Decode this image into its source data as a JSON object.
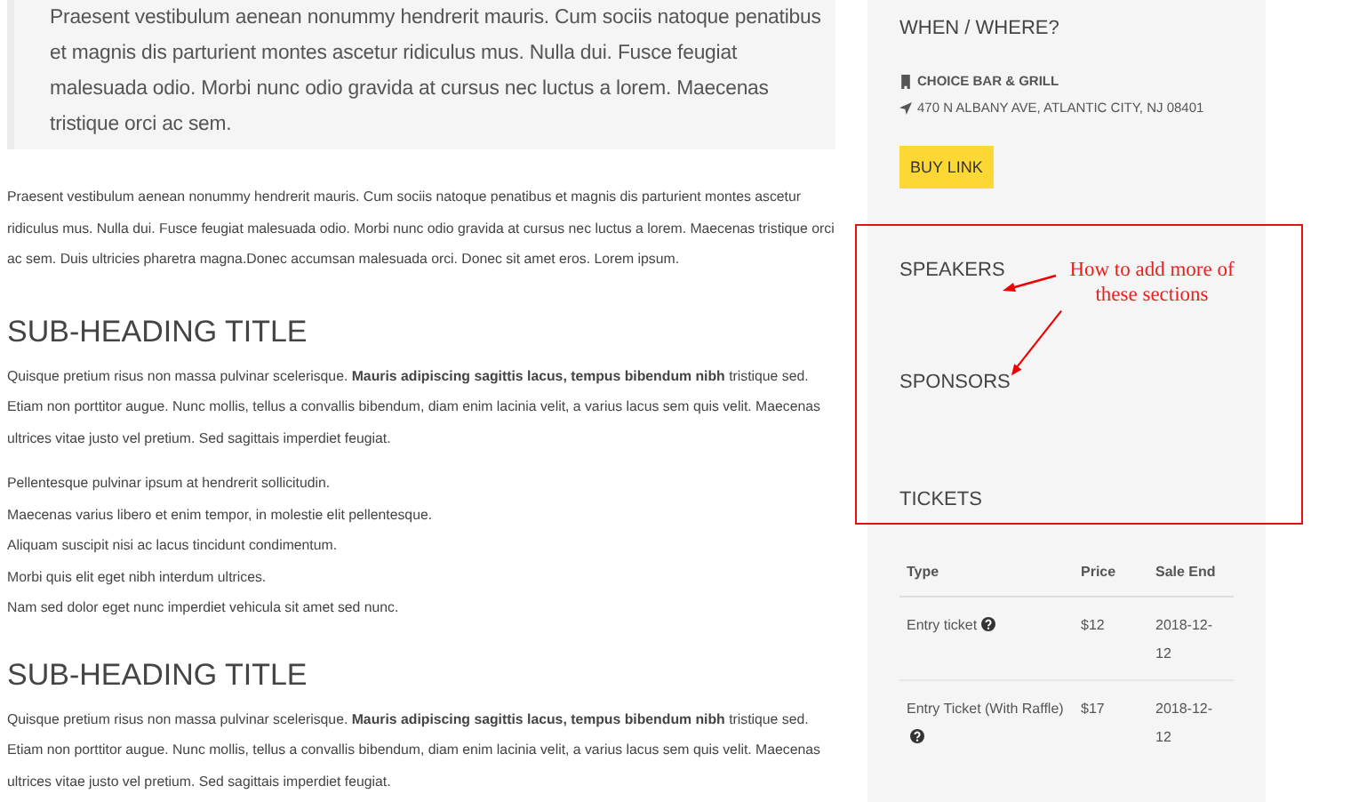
{
  "blockquote": "Praesent vestibulum aenean nonummy hendrerit mauris. Cum sociis natoque penatibus et magnis dis parturient montes ascetur ridiculus mus. Nulla dui. Fusce feugiat malesuada odio. Morbi nunc odio gravida at cursus nec luctus a lorem. Maecenas tristique orci ac sem.",
  "intro": "Praesent vestibulum aenean nonummy hendrerit mauris. Cum sociis natoque penatibus et magnis dis parturient montes ascetur ridiculus mus. Nulla dui. Fusce feugiat malesuada odio. Morbi nunc odio gravida at cursus nec luctus a lorem. Maecenas tristique orci ac sem. Duis ultricies pharetra magna.Donec accumsan malesuada orci. Donec sit amet eros. Lorem ipsum.",
  "sections": [
    {
      "heading": "SUB-HEADING TITLE",
      "paragraph": "Quisque pretium risus non massa pulvinar scelerisque. **Mauris adipiscing sagittis lacus, tempus bibendum nibh** tristique sed. Etiam non porttitor augue. Nunc mollis, tellus a convallis bibendum, diam enim lacinia velit, a varius lacus sem quis velit. Maecenas ultrices vitae justo vel pretium. Sed sagittais imperdiet feugiat.",
      "lines": [
        "Pellentesque pulvinar ipsum at hendrerit sollicitudin.",
        "Maecenas varius libero et enim tempor, in molestie elit pellentesque.",
        "Aliquam suscipit nisi ac lacus tincidunt condimentum.",
        "Morbi quis elit eget nibh interdum ultrices.",
        "Nam sed dolor eget nunc imperdiet vehicula sit amet sed nunc."
      ]
    },
    {
      "heading": "SUB-HEADING TITLE",
      "paragraph": "Quisque pretium risus non massa pulvinar scelerisque. **Mauris adipiscing sagittis lacus, tempus bibendum nibh** tristique sed. Etiam non porttitor augue. Nunc mollis, tellus a convallis bibendum, diam enim lacinia velit, a varius lacus sem quis velit. Maecenas ultrices vitae justo vel pretium. Sed sagittais imperdiet feugiat."
    }
  ],
  "sidebar": {
    "title": "WHEN / WHERE?",
    "venue": "CHOICE BAR & GRILL",
    "address": "470 N ALBANY AVE, ATLANTIC CITY, NJ 08401",
    "buy_button": "BUY LINK",
    "sections": [
      "SPEAKERS",
      "SPONSORS"
    ],
    "tickets_title": "TICKETS",
    "tickets": {
      "columns": [
        "Type",
        "Price",
        "Sale End"
      ],
      "rows": [
        {
          "type": "Entry ticket",
          "help": true,
          "price": "$12",
          "sale_end": "2018-12-12"
        },
        {
          "type": "Entry Ticket (With Raffle)",
          "help": true,
          "price": "$17",
          "sale_end": "2018-12-12"
        }
      ]
    }
  },
  "annotation": {
    "note": "How to add more of these sections"
  }
}
